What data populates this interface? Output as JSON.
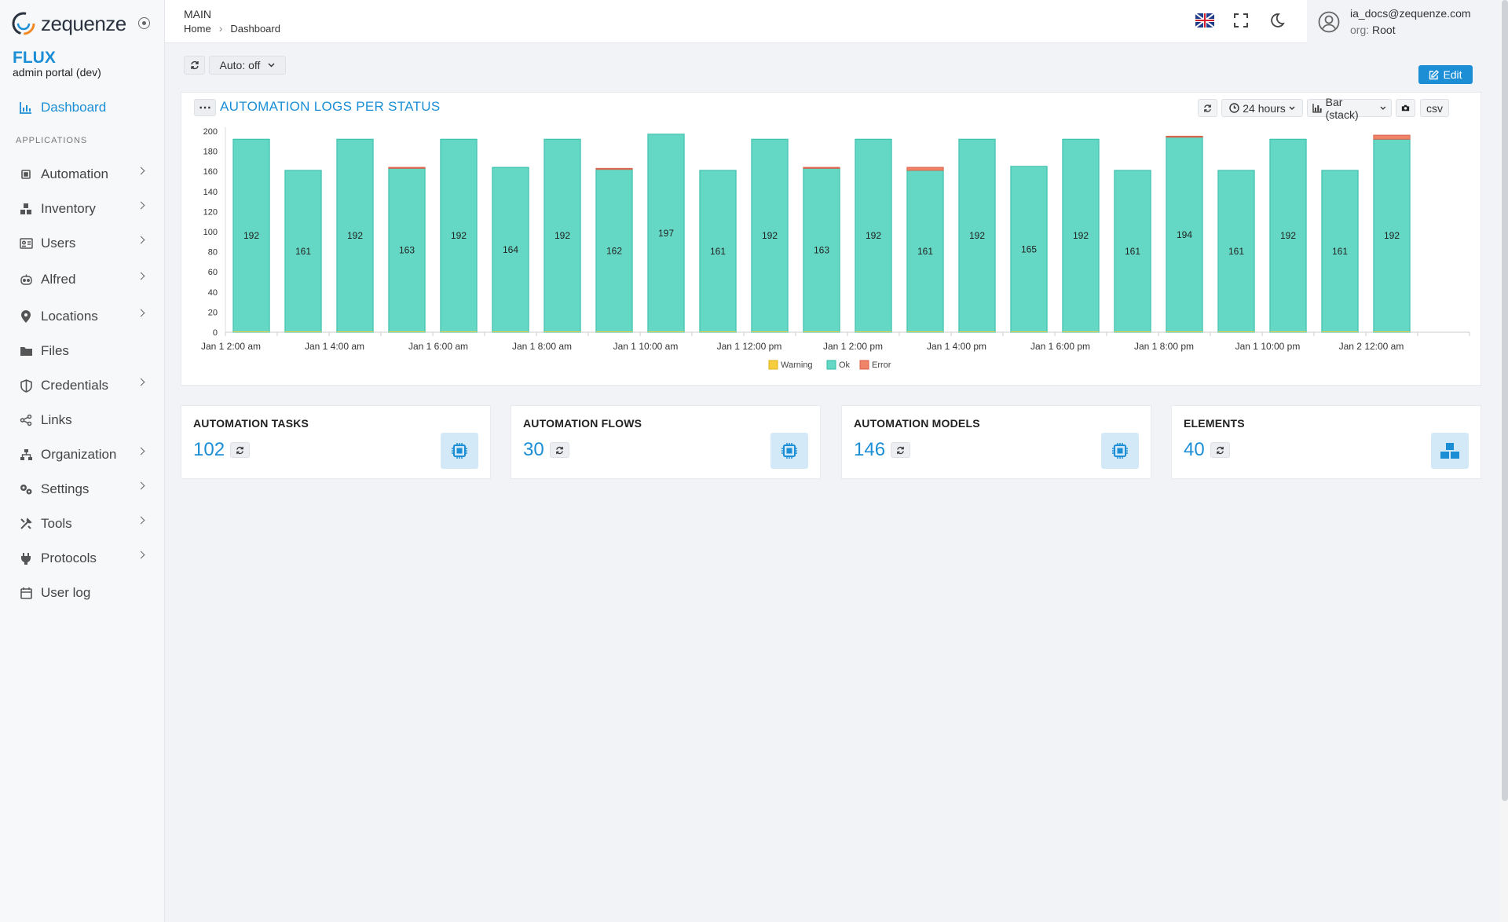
{
  "app": {
    "logo_text": "zequenze",
    "brand": "FLUX",
    "brand_sub": "admin portal (dev)"
  },
  "sidebar": {
    "dashboard": "Dashboard",
    "section": "APPLICATIONS",
    "items": [
      {
        "label": "Automation",
        "icon": "cpu-icon"
      },
      {
        "label": "Inventory",
        "icon": "boxes-icon"
      },
      {
        "label": "Users",
        "icon": "id-card-icon"
      },
      {
        "label": "Alfred",
        "icon": "robot-icon"
      },
      {
        "label": "Locations",
        "icon": "map-pin-icon"
      },
      {
        "label": "Files",
        "icon": "folder-icon"
      },
      {
        "label": "Credentials",
        "icon": "shield-icon"
      },
      {
        "label": "Links",
        "icon": "share-icon"
      },
      {
        "label": "Organization",
        "icon": "sitemap-icon"
      },
      {
        "label": "Settings",
        "icon": "gears-icon"
      },
      {
        "label": "Tools",
        "icon": "tools-icon"
      },
      {
        "label": "Protocols",
        "icon": "plug-icon"
      },
      {
        "label": "User log",
        "icon": "calendar-icon"
      }
    ]
  },
  "header": {
    "title": "MAIN",
    "crumb_home": "Home",
    "crumb_current": "Dashboard",
    "user_email": "ia_docs@zequenze.com",
    "org_label": "org:",
    "org_value": "Root"
  },
  "toolbar": {
    "auto_label": "Auto: off",
    "edit_label": "Edit"
  },
  "chart_panel": {
    "title": "AUTOMATION LOGS PER STATUS",
    "range_label": "24 hours",
    "chart_mode_label": "Bar (stack)",
    "csv_label": "csv"
  },
  "chart_data": {
    "type": "bar",
    "stacked": true,
    "ylim": [
      0,
      200
    ],
    "yticks": [
      0,
      20,
      40,
      60,
      80,
      100,
      120,
      140,
      160,
      180,
      200
    ],
    "x_tick_labels": [
      "Jan 1 2:00 am",
      "Jan 1 4:00 am",
      "Jan 1 6:00 am",
      "Jan 1 8:00 am",
      "Jan 1 10:00 am",
      "Jan 1 12:00 pm",
      "Jan 1 2:00 pm",
      "Jan 1 4:00 pm",
      "Jan 1 6:00 pm",
      "Jan 1 8:00 pm",
      "Jan 1 10:00 pm",
      "Jan 2 12:00 am"
    ],
    "legend_position": "bottom-center",
    "series": [
      {
        "name": "Warning",
        "color": "#f5cd3d",
        "values": [
          0,
          0,
          0,
          0,
          0,
          0,
          0,
          0,
          0,
          0,
          0,
          0,
          0,
          0,
          0,
          0,
          0,
          0,
          0,
          0,
          0,
          0,
          0,
          0
        ]
      },
      {
        "name": "Ok",
        "color": "#64d8c4",
        "values": [
          192,
          161,
          192,
          163,
          192,
          164,
          192,
          162,
          197,
          161,
          192,
          163,
          192,
          161,
          192,
          165,
          192,
          161,
          194,
          161,
          192,
          161,
          192,
          0
        ]
      },
      {
        "name": "Error",
        "color": "#f08468",
        "values": [
          0,
          0,
          0,
          1,
          0,
          0,
          0,
          1,
          0,
          0,
          0,
          1,
          0,
          3,
          0,
          0,
          0,
          0,
          1,
          0,
          0,
          0,
          4,
          0
        ]
      }
    ],
    "bar_labels": [
      192,
      161,
      192,
      163,
      192,
      164,
      192,
      162,
      197,
      161,
      192,
      163,
      192,
      161,
      192,
      165,
      192,
      161,
      194,
      161,
      192,
      161,
      192,
      null
    ]
  },
  "cards": [
    {
      "title": "AUTOMATION TASKS",
      "value": "102",
      "icon": "cpu-icon"
    },
    {
      "title": "AUTOMATION FLOWS",
      "value": "30",
      "icon": "cpu-icon"
    },
    {
      "title": "AUTOMATION MODELS",
      "value": "146",
      "icon": "cpu-icon"
    },
    {
      "title": "ELEMENTS",
      "value": "40",
      "icon": "boxes-icon"
    }
  ]
}
